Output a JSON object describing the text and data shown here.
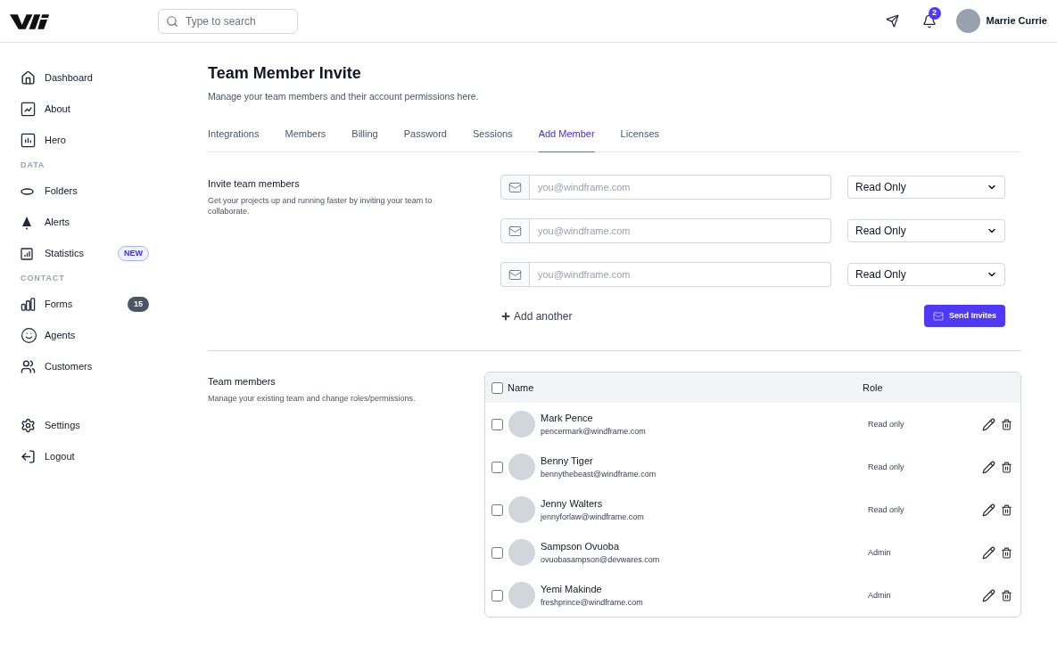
{
  "header": {
    "search": {
      "placeholder": "Type to search"
    },
    "notifications": {
      "count": "2"
    },
    "user": {
      "name": "Marrie Currie"
    }
  },
  "sidebar": [
    {
      "kind": "item",
      "label": "Dashboard"
    },
    {
      "kind": "item",
      "label": "About"
    },
    {
      "kind": "item",
      "label": "Hero"
    },
    {
      "kind": "heading",
      "label": "DATA"
    },
    {
      "kind": "item",
      "label": "Folders"
    },
    {
      "kind": "item",
      "label": "Alerts"
    },
    {
      "kind": "item",
      "label": "Statistics",
      "badge": {
        "kind": "new",
        "text": "NEW"
      }
    },
    {
      "kind": "heading",
      "label": "CONTACT"
    },
    {
      "kind": "item",
      "label": "Forms",
      "badge": {
        "kind": "count",
        "text": "15"
      }
    },
    {
      "kind": "item",
      "label": "Agents"
    },
    {
      "kind": "item",
      "label": "Customers"
    },
    {
      "kind": "spacer"
    },
    {
      "kind": "item",
      "label": "Settings"
    },
    {
      "kind": "item",
      "label": "Logout"
    }
  ],
  "page": {
    "title": "Team Member Invite",
    "subtitle": "Manage your team members and their account permissions here."
  },
  "tabs": [
    {
      "label": "Integrations",
      "selected": false
    },
    {
      "label": "Members",
      "selected": false
    },
    {
      "label": "Billing",
      "selected": false
    },
    {
      "label": "Password",
      "selected": false
    },
    {
      "label": "Sessions",
      "selected": false
    },
    {
      "label": "Add Member",
      "selected": true
    },
    {
      "label": "Licenses",
      "selected": false
    }
  ],
  "invite": {
    "title": "Invite team members",
    "description": "Get your projects up and running faster by inviting your team to collaborate.",
    "rows": [
      {
        "placeholder": "you@windframe.com",
        "role": "Read Only"
      },
      {
        "placeholder": "you@windframe.com",
        "role": "Read Only"
      },
      {
        "placeholder": "you@windframe.com",
        "role": "Read Only"
      }
    ],
    "add_another": "Add another",
    "send": "Send Invites"
  },
  "team": {
    "title": "Team members",
    "description": "Manage your existing team and change roles/permissions.",
    "columns": [
      "Name",
      "Role"
    ],
    "header_checked": false,
    "rows": [
      {
        "name": "Mark Pence",
        "email": "pencermark@windframe.com",
        "role": "Read only",
        "checked": false
      },
      {
        "name": "Benny Tiger",
        "email": "bennythebeast@windframe.com",
        "role": "Read only",
        "checked": false
      },
      {
        "name": "Jenny Walters",
        "email": "jennyforlaw@windframe.com",
        "role": "Read only",
        "checked": false
      },
      {
        "name": "Sampson Ovuoba",
        "email": "ovuobasampson@devwares.com",
        "role": "Admin",
        "checked": false
      },
      {
        "name": "Yemi Makinde",
        "email": "freshprince@windframe.com",
        "role": "Admin",
        "checked": false
      }
    ]
  }
}
